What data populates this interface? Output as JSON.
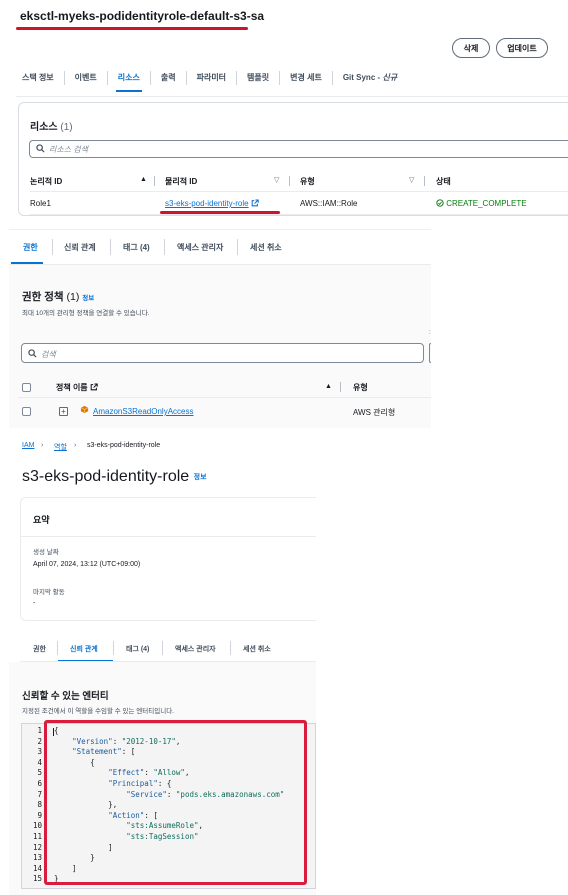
{
  "stack": {
    "title": "eksctl-myeks-podidentityrole-default-s3-sa",
    "delete_label": "삭제",
    "update_label": "업데이트",
    "tabs": [
      "스택 정보",
      "이벤트",
      "리소스",
      "출력",
      "파라미터",
      "템플릿",
      "변경 세트",
      "Git Sync - 신규"
    ],
    "active_tab_index": 2,
    "resources_title": "리소스",
    "resources_count": "(1)",
    "search_placeholder": "리소스 검색",
    "columns": [
      "논리적 ID",
      "물리적 ID",
      "유형",
      "상태"
    ],
    "rows": [
      {
        "logical_id": "Role1",
        "physical_id": "s3-eks-pod-identity-role",
        "type": "AWS::IAM::Role",
        "status": "CREATE_COMPLETE"
      }
    ],
    "status_color": "#037f0c"
  },
  "permissions": {
    "tabs": [
      "권한",
      "신뢰 관계",
      "태그 (4)",
      "액세스 관리자",
      "세션 취소"
    ],
    "active_tab_index": 0,
    "title": "권한 정책",
    "count": "(1)",
    "info_label": "정보",
    "description": "최대 10개의 관리형 정책을 연결할 수 있습니다.",
    "search_placeholder": "검색",
    "columns": [
      "정책 이름",
      "유형"
    ],
    "rows": [
      {
        "name": "AmazonS3ReadOnlyAccess",
        "type": "AWS 관리형"
      }
    ]
  },
  "role": {
    "breadcrumb": [
      "IAM",
      "역할",
      "s3-eks-pod-identity-role"
    ],
    "title": "s3-eks-pod-identity-role",
    "info_label": "정보",
    "summary_label": "요약",
    "created_label": "생성 날짜",
    "created_value": "April 07, 2024, 13:12 (UTC+09:00)",
    "last_activity_label": "마지막 활동",
    "last_activity_value": "-",
    "tabs": [
      "권한",
      "신뢰 관계",
      "태그 (4)",
      "액세스 관리자",
      "세션 취소"
    ],
    "active_tab_index": 1,
    "trust_title": "신뢰할 수 있는 엔터티",
    "trust_description": "지정된 조건에서 이 역할을 수임할 수 있는 엔터티입니다.",
    "code_lines": [
      "{",
      "    \"Version\": \"2012-10-17\",",
      "    \"Statement\": [",
      "        {",
      "            \"Effect\": \"Allow\",",
      "            \"Principal\": {",
      "                \"Service\": \"pods.eks.amazonaws.com\"",
      "            },",
      "            \"Action\": [",
      "                \"sts:AssumeRole\",",
      "                \"sts:TagSession\"",
      "            ]",
      "        }",
      "    ]",
      "}"
    ],
    "highlight_color": "#d91b3d"
  }
}
